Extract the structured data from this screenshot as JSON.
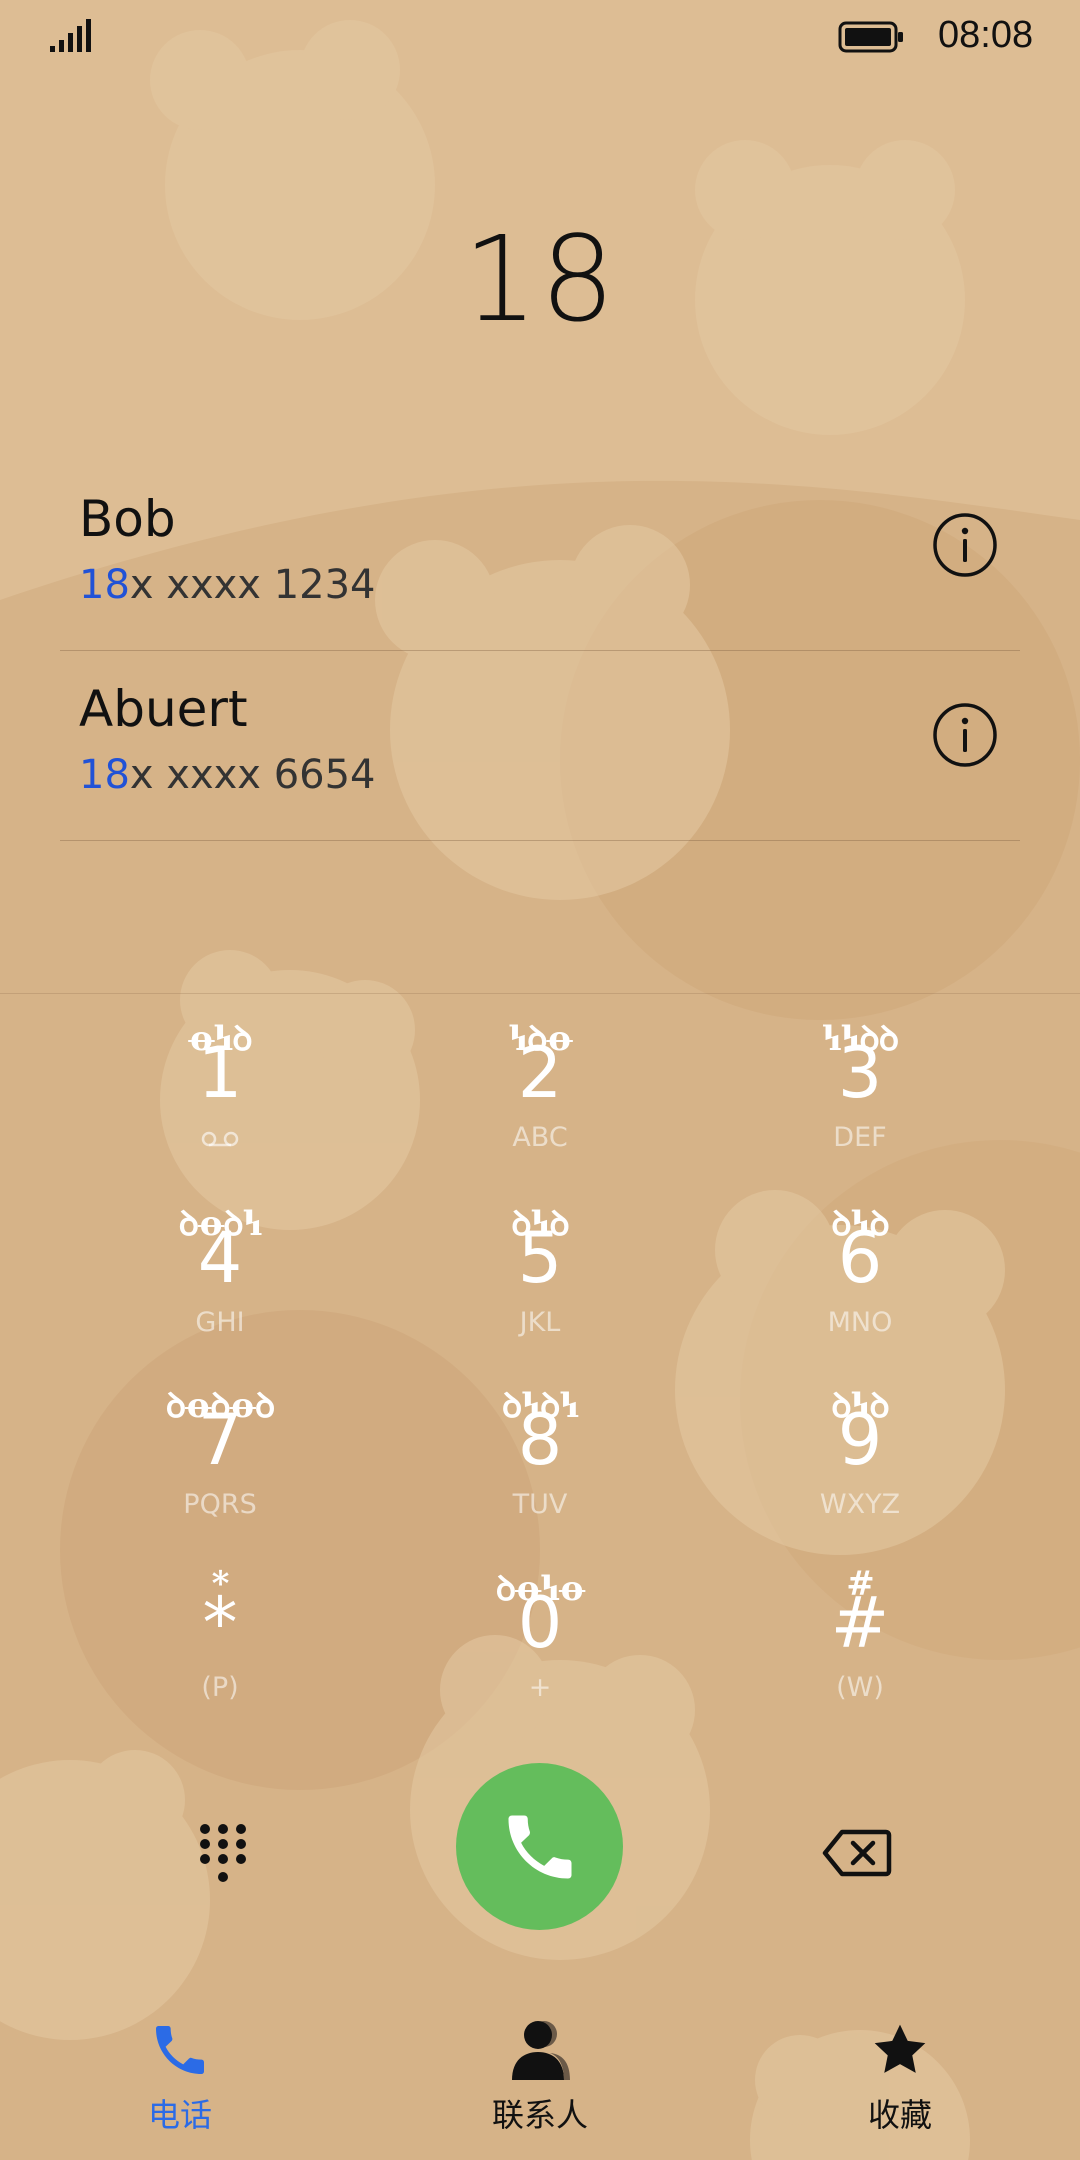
{
  "status_bar": {
    "time": "08:08",
    "signal_icon": "signal-bars-icon",
    "battery_icon": "battery-icon"
  },
  "dialer": {
    "number": "18"
  },
  "contacts": [
    {
      "name": "Bob",
      "number_match": "18",
      "number_rest": "x xxxx 1234",
      "info_icon": "info-icon"
    },
    {
      "name": "Abuert",
      "number_match": "18",
      "number_rest": "x xxxx 6654",
      "info_icon": "info-icon"
    }
  ],
  "keypad": {
    "keys": [
      {
        "digit": "1",
        "alt": "ꝋꝇꝺ",
        "letters": ""
      },
      {
        "digit": "2",
        "alt": "ꝇꝺꝋ",
        "letters": "ABC"
      },
      {
        "digit": "3",
        "alt": "ꝇꝇꝺꝺ",
        "letters": "DEF"
      },
      {
        "digit": "4",
        "alt": "ꝺꝋꝺꝇ",
        "letters": "GHI"
      },
      {
        "digit": "5",
        "alt": "ꝺꝇꝺ",
        "letters": "JKL"
      },
      {
        "digit": "6",
        "alt": "ꝺꝇꝺ",
        "letters": "MNO"
      },
      {
        "digit": "7",
        "alt": "ꝺꝋꝺꝋꝺ",
        "letters": "PQRS"
      },
      {
        "digit": "8",
        "alt": "ꝺꝇꝺꝇ",
        "letters": "TUV"
      },
      {
        "digit": "9",
        "alt": "ꝺꝇꝺ",
        "letters": "WXYZ"
      },
      {
        "digit": "*",
        "alt": "*",
        "letters": "(P)"
      },
      {
        "digit": "0",
        "alt": "ꝺꝋꝇꝋ",
        "letters": "+"
      },
      {
        "digit": "#",
        "alt": "#",
        "letters": "(W)"
      }
    ]
  },
  "actions": {
    "dialpad_icon": "dialpad-grid-icon",
    "call_icon": "phone-icon",
    "backspace_icon": "backspace-icon"
  },
  "nav": {
    "phone": "电话",
    "contacts": "联系人",
    "favorites": "收藏"
  },
  "colors": {
    "background": "#d6b388",
    "accent": "#2b6be6",
    "call_green": "#64bd5c"
  }
}
